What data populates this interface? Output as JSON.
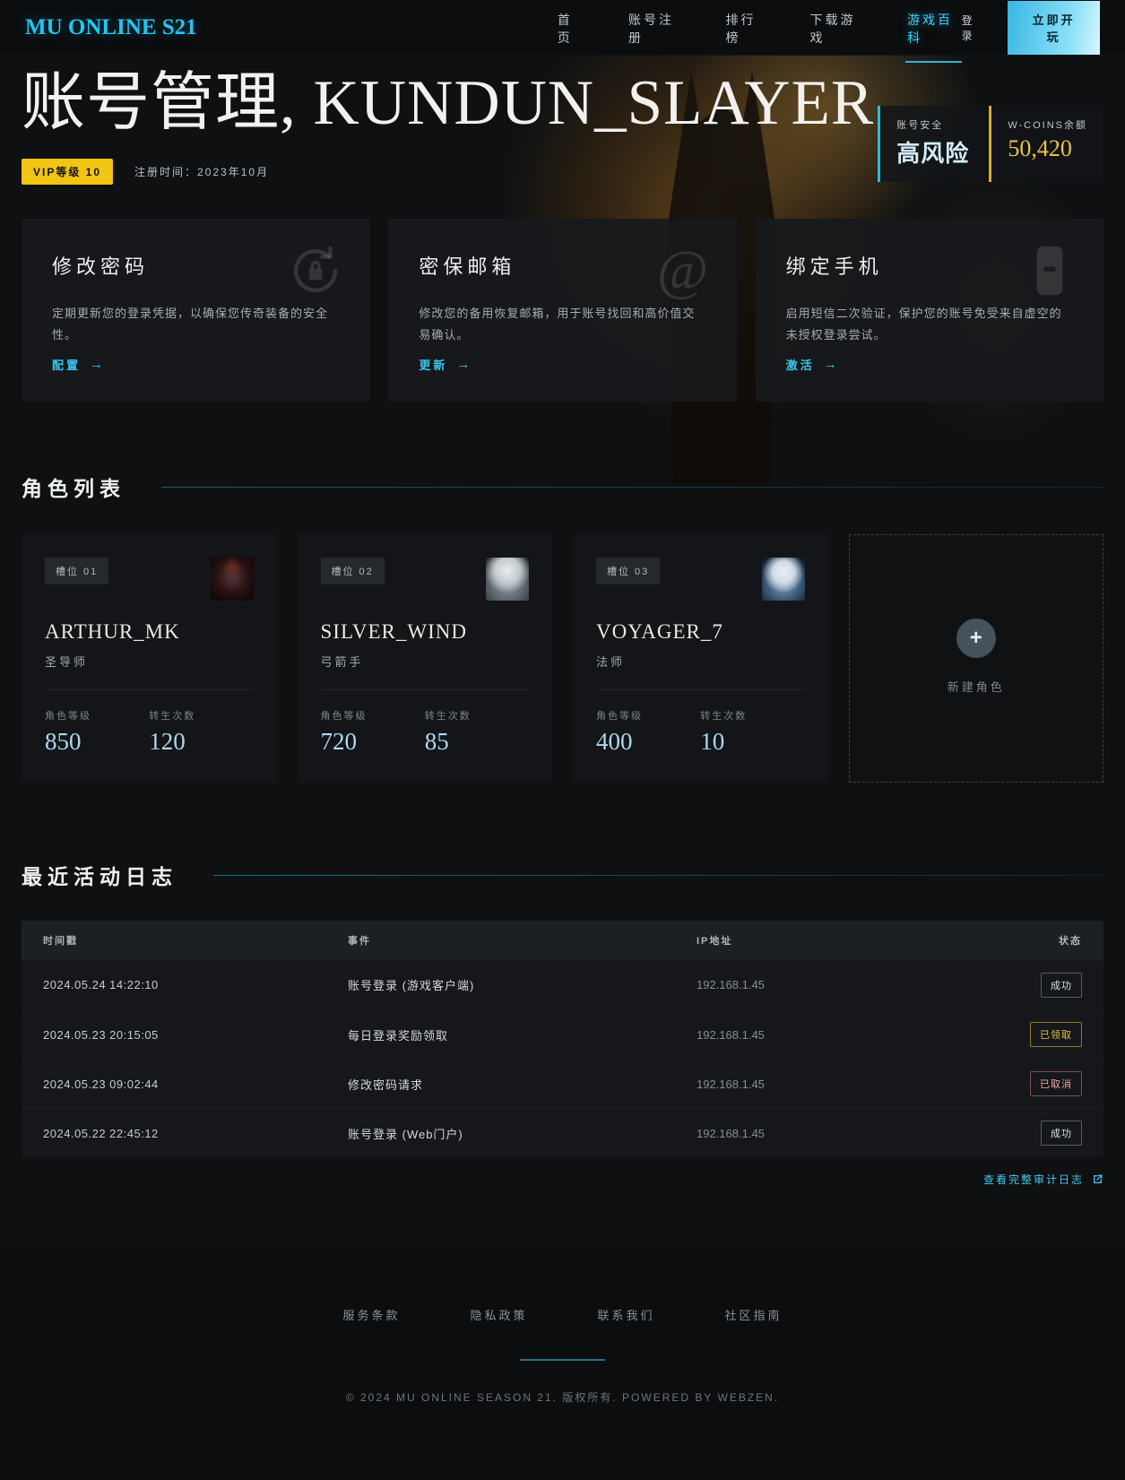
{
  "header": {
    "logo": "MU ONLINE S21",
    "nav_items": [
      {
        "label": "首页",
        "active": false
      },
      {
        "label": "账号注册",
        "active": false
      },
      {
        "label": "排行榜",
        "active": false
      },
      {
        "label": "下载游戏",
        "active": false
      },
      {
        "label": "游戏百科",
        "active": true
      }
    ],
    "login_label": "登录",
    "play_button_label": "立即开玩"
  },
  "hero": {
    "title": "账号管理, KUNDUN_SLAYER",
    "vip_badge": "VIP等级 10",
    "register_time": "注册时间：2023年10月",
    "stats": [
      {
        "label": "账号安全",
        "value": "高风险",
        "type": "risk",
        "accent": "#2fb9dd"
      },
      {
        "label": "W-COINS余额",
        "value": "50,420",
        "type": "coins",
        "accent": "#d8af2c"
      }
    ]
  },
  "security_cards": [
    {
      "title": "修改密码",
      "icon": "lock-reset-icon",
      "desc": "定期更新您的登录凭据，以确保您传奇装备的安全性。",
      "link_label": "配置"
    },
    {
      "title": "密保邮箱",
      "icon": "at-icon",
      "desc": "修改您的备用恢复邮箱，用于账号找回和高价值交易确认。",
      "link_label": "更新"
    },
    {
      "title": "绑定手机",
      "icon": "phone-icon",
      "desc": "启用短信二次验证，保护您的账号免受来自虚空的未授权登录尝试。",
      "link_label": "激活"
    }
  ],
  "characters": {
    "heading": "角色列表",
    "level_label": "角色等级",
    "resets_label": "转生次数",
    "list": [
      {
        "slot": "槽位 01",
        "name": "ARTHUR_MK",
        "class": "圣导师",
        "level": "850",
        "resets": "120",
        "avatar": "dark-knight-avatar"
      },
      {
        "slot": "槽位 02",
        "name": "SILVER_WIND",
        "class": "弓箭手",
        "level": "720",
        "resets": "85",
        "avatar": "elf-avatar"
      },
      {
        "slot": "槽位 03",
        "name": "VOYAGER_7",
        "class": "法师",
        "level": "400",
        "resets": "10",
        "avatar": "wizard-avatar"
      }
    ],
    "create_new_label": "新建角色"
  },
  "activity": {
    "heading": "最近活动日志",
    "columns": [
      "时间戳",
      "事件",
      "IP地址",
      "状态"
    ],
    "rows": [
      {
        "time": "2024.05.24 14:22:10",
        "event": "账号登录 (游戏客户端)",
        "ip": "192.168.1.45",
        "status": "成功",
        "status_type": "success"
      },
      {
        "time": "2024.05.23 20:15:05",
        "event": "每日登录奖励领取",
        "ip": "192.168.1.45",
        "status": "已领取",
        "status_type": "claimed"
      },
      {
        "time": "2024.05.23 09:02:44",
        "event": "修改密码请求",
        "ip": "192.168.1.45",
        "status": "已取消",
        "status_type": "cancelled"
      },
      {
        "time": "2024.05.22 22:45:12",
        "event": "账号登录 (Web门户)",
        "ip": "192.168.1.45",
        "status": "成功",
        "status_type": "success"
      }
    ],
    "view_full_link_label": "查看完整审计日志"
  },
  "footer": {
    "links": [
      "服务条款",
      "隐私政策",
      "联系我们",
      "社区指南"
    ],
    "copyright": "© 2024 MU ONLINE SEASON 21. 版权所有. POWERED BY WEBZEN."
  }
}
